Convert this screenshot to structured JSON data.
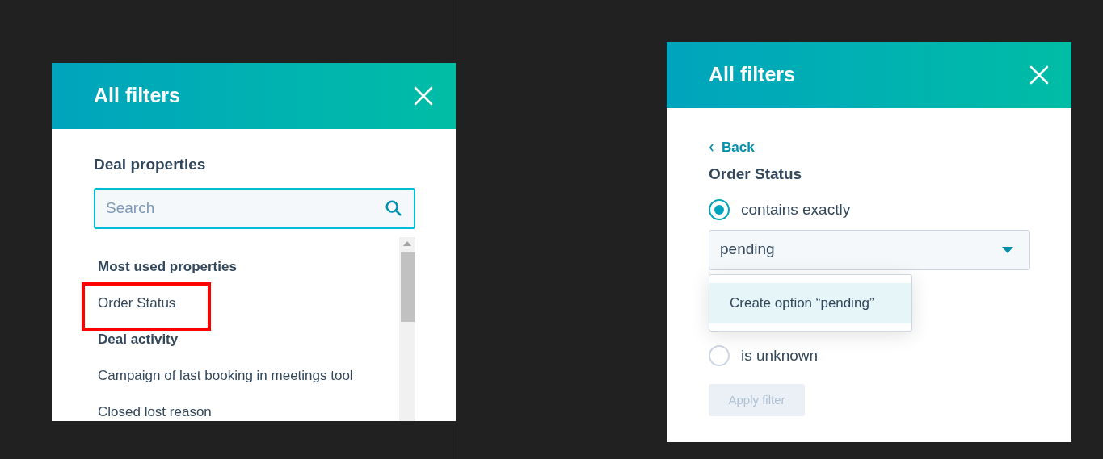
{
  "left_panel": {
    "title": "All filters",
    "section_title": "Deal properties",
    "search": {
      "placeholder": "Search"
    },
    "list": [
      {
        "kind": "heading",
        "label": "Most used properties",
        "highlighted": false
      },
      {
        "kind": "item",
        "label": "Order Status",
        "highlighted": true
      },
      {
        "kind": "heading",
        "label": "Deal activity",
        "highlighted": false
      },
      {
        "kind": "item",
        "label": "Campaign of last booking in meetings tool",
        "highlighted": false
      },
      {
        "kind": "item",
        "label": "Closed lost reason",
        "highlighted": false
      }
    ]
  },
  "right_panel": {
    "title": "All filters",
    "back": "Back",
    "property": "Order Status",
    "operators": [
      {
        "label": "contains exactly",
        "selected": true
      },
      {
        "label": "is unknown",
        "selected": false
      }
    ],
    "select": {
      "value": "pending"
    },
    "dropdown_options": [
      {
        "label": "Create option “pending”",
        "selected": true
      }
    ],
    "apply_button": {
      "label": "Apply filter",
      "disabled": true
    }
  }
}
